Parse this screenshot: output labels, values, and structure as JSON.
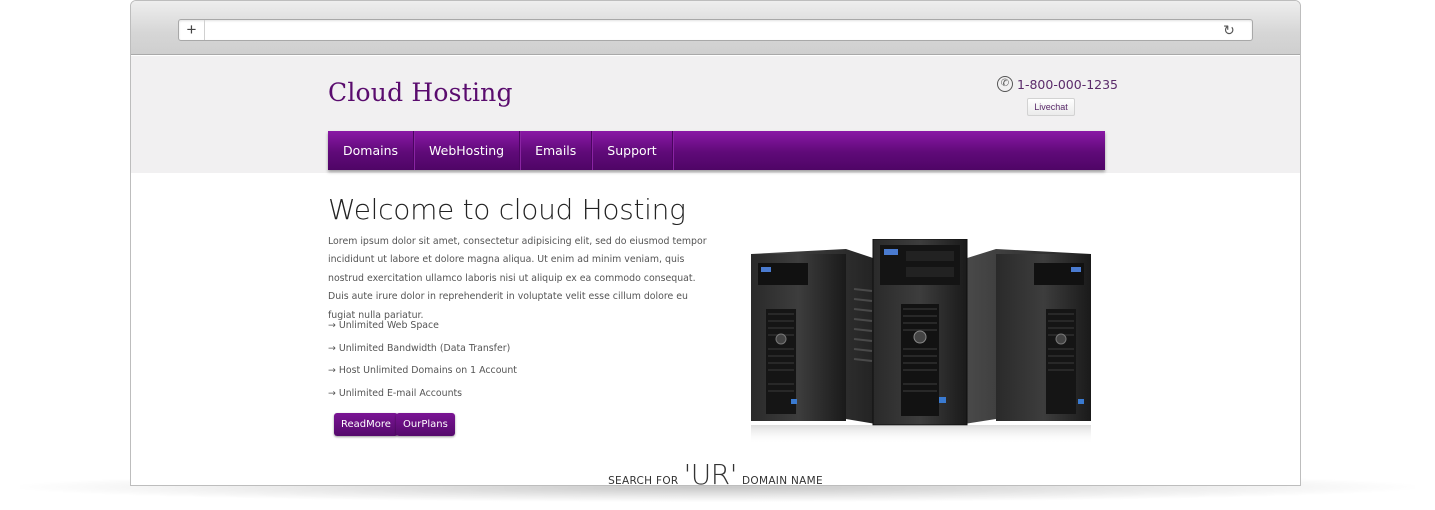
{
  "browser": {
    "plus_icon": "plus-icon",
    "reload_icon": "reload-icon"
  },
  "header": {
    "logo": "Cloud Hosting",
    "phone": "1-800-000-1235",
    "phone_icon": "phone-icon",
    "livechat": "Livechat"
  },
  "nav": {
    "items": [
      {
        "label": "Domains"
      },
      {
        "label": "WebHosting"
      },
      {
        "label": "Emails"
      },
      {
        "label": "Support"
      }
    ]
  },
  "main": {
    "title": "Welcome to cloud Hosting",
    "body": "Lorem ipsum dolor sit amet, consectetur adipisicing elit, sed do eiusmod tempor incididunt ut labore et dolore magna aliqua. Ut enim ad minim veniam, quis nostrud exercitation ullamco laboris nisi ut aliquip ex ea commodo consequat. Duis aute irure dolor in reprehenderit in voluptate velit esse cillum dolore eu fugiat nulla pariatur.",
    "features": [
      "→ Unlimited Web Space",
      "→ Unlimited Bandwidth (Data Transfer)",
      "→ Host Unlimited Domains on 1 Account",
      "→ Unlimited E-mail Accounts"
    ],
    "buttons": {
      "read_more": "ReadMore",
      "our_plans": "OurPlans"
    }
  },
  "search": {
    "prefix": "SEARCH FOR",
    "highlight": "'UR'",
    "suffix": "DOMAIN NAME"
  },
  "colors": {
    "brand_purple": "#5a0c6e",
    "nav_purple": "#6a0c85",
    "header_band": "#f1f0f1"
  }
}
